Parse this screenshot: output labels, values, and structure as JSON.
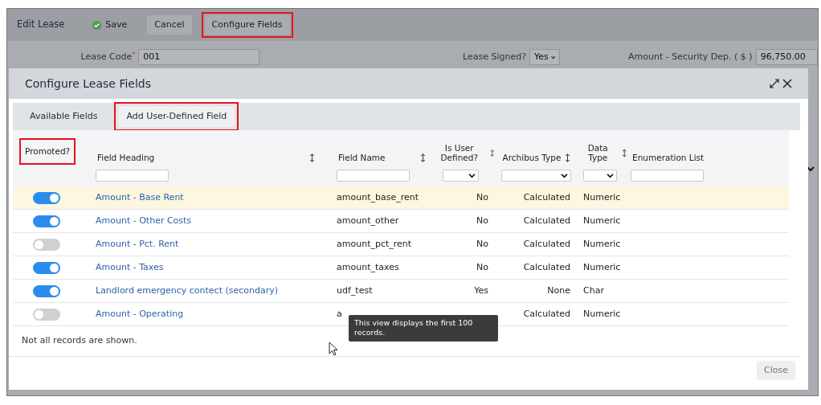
{
  "toolbar": {
    "title": "Edit Lease",
    "buttons": [
      {
        "label": "Save",
        "kind": "save",
        "highlighted": false
      },
      {
        "label": "Cancel",
        "kind": "plain",
        "highlighted": false
      },
      {
        "label": "Configure Fields",
        "kind": "plain",
        "highlighted": true
      }
    ]
  },
  "form": [
    {
      "label": "Lease Code",
      "required_mark": "*",
      "kind": "text",
      "value": "001"
    },
    {
      "label": "Lease Signed?",
      "kind": "select",
      "value": "Yes"
    },
    {
      "label": "Amount - Security Dep. ( $ )",
      "kind": "text",
      "value": "96,750.00"
    }
  ],
  "dialog": {
    "title": "Configure Lease Fields",
    "tabs": [
      {
        "label": "Available Fields",
        "selected": true,
        "highlighted": false
      },
      {
        "label": "Add User-Defined Field",
        "selected": false,
        "highlighted": true
      }
    ],
    "columns": [
      {
        "label": "Promoted?",
        "kind": "plain",
        "sortable": false,
        "highlighted": true
      },
      {
        "label": "Field Heading",
        "kind": "textfilter",
        "sortable": true,
        "highlighted": false
      },
      {
        "label": "Field Name",
        "kind": "textfilter",
        "sortable": true,
        "highlighted": false
      },
      {
        "label": "Is User Defined?",
        "kind": "selectfilter",
        "sortable": true,
        "highlighted": false
      },
      {
        "label": "Archibus Type",
        "kind": "selectfilter",
        "sortable": true,
        "highlighted": false
      },
      {
        "label": "Data Type",
        "kind": "selectfilter",
        "sortable": true,
        "highlighted": false
      },
      {
        "label": "Enumeration List",
        "kind": "textfilter",
        "sortable": false,
        "highlighted": false
      }
    ],
    "rows": [
      {
        "selected": true,
        "promoted": true,
        "heading": "Amount - Base Rent",
        "field_name": "amount_base_rent",
        "user_defined": "No",
        "archibus_type": "Calculated",
        "data_type": "Numeric"
      },
      {
        "selected": false,
        "promoted": true,
        "heading": "Amount - Other Costs",
        "field_name": "amount_other",
        "user_defined": "No",
        "archibus_type": "Calculated",
        "data_type": "Numeric"
      },
      {
        "selected": false,
        "promoted": false,
        "heading": "Amount - Pct. Rent",
        "field_name": "amount_pct_rent",
        "user_defined": "No",
        "archibus_type": "Calculated",
        "data_type": "Numeric"
      },
      {
        "selected": false,
        "promoted": true,
        "heading": "Amount - Taxes",
        "field_name": "amount_taxes",
        "user_defined": "No",
        "archibus_type": "Calculated",
        "data_type": "Numeric"
      },
      {
        "selected": false,
        "promoted": true,
        "heading": "Landlord emergency contect (secondary)",
        "field_name": "udf_test",
        "user_defined": "Yes",
        "archibus_type": "None",
        "data_type": "Char"
      },
      {
        "selected": false,
        "promoted": false,
        "heading": "Amount - Operating",
        "field_name": "a",
        "archibus_type": "Calculated",
        "data_type": "Numeric"
      }
    ],
    "note": "Not all records are shown.",
    "tooltip": "This view displays the first 100 records.",
    "close_button": "Close"
  }
}
